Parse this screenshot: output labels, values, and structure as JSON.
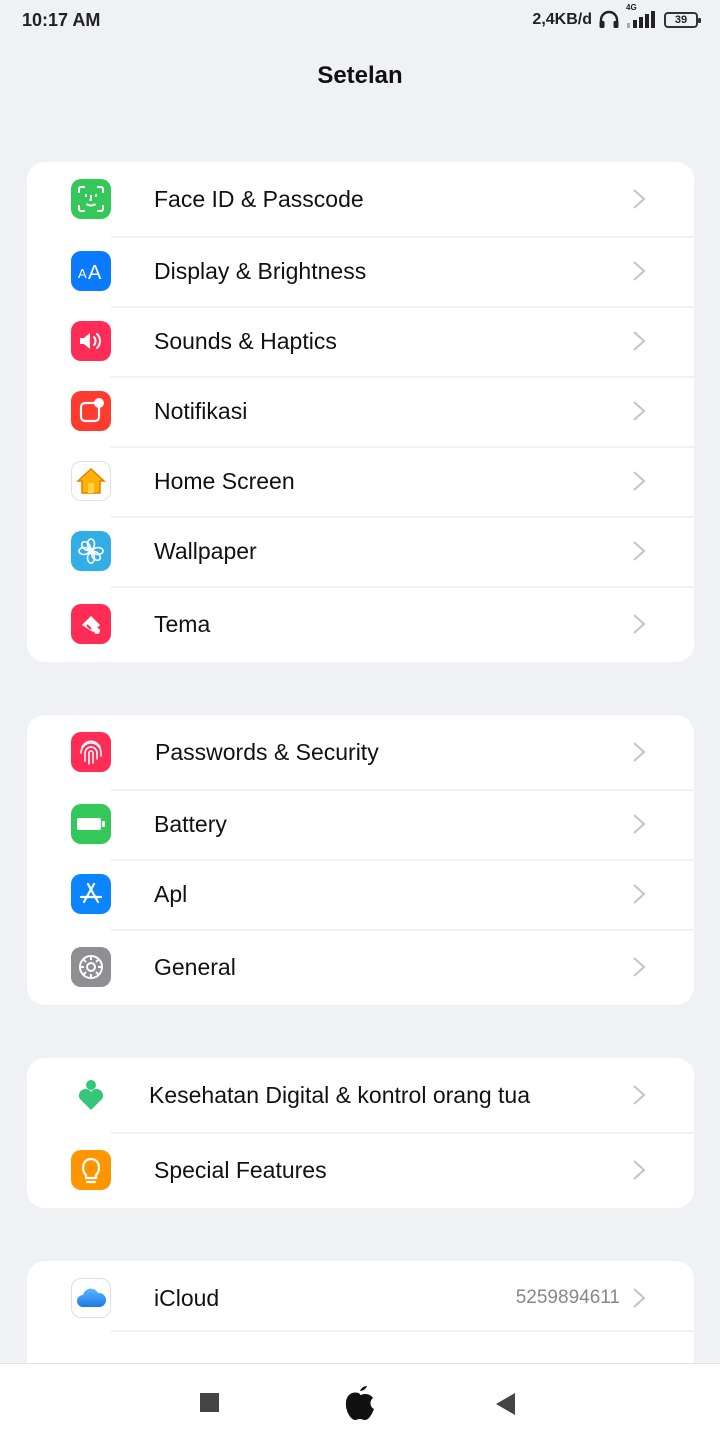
{
  "status_bar": {
    "time": "10:17 AM",
    "net_speed": "2,4KB/d",
    "signal_label": "4G",
    "battery": "39"
  },
  "header": {
    "title": "Setelan"
  },
  "groups": [
    {
      "items": [
        {
          "label": "Face ID & Passcode",
          "icon": "face-id-icon",
          "color": "#34c759"
        },
        {
          "label": "Display & Brightness",
          "icon": "display-brightness-icon",
          "color": "#0a7aff"
        },
        {
          "label": "Sounds & Haptics",
          "icon": "speaker-icon",
          "color": "#ff2d55"
        },
        {
          "label": "Notifikasi",
          "icon": "notification-icon",
          "color": "#ff3b30"
        },
        {
          "label": "Home Screen",
          "icon": "home-icon",
          "color": "#ffb300"
        },
        {
          "label": "Wallpaper",
          "icon": "flower-icon",
          "color": "#32ade6"
        },
        {
          "label": "Tema",
          "icon": "brush-icon",
          "color": "#ff2d55"
        }
      ]
    },
    {
      "items": [
        {
          "label": "Passwords & Security",
          "icon": "fingerprint-icon",
          "color": "#ff2d55"
        },
        {
          "label": "Battery",
          "icon": "battery-icon",
          "color": "#34c759"
        },
        {
          "label": "Apl",
          "icon": "app-store-icon",
          "color": "#0a84ff"
        },
        {
          "label": "General",
          "icon": "gear-icon",
          "color": "#8e8e93"
        }
      ]
    },
    {
      "items": [
        {
          "label": "Kesehatan Digital & kontrol orang tua",
          "icon": "digital-health-icon",
          "color": "#34c77b"
        },
        {
          "label": "Special Features",
          "icon": "lightbulb-icon",
          "color": "#ff9500"
        }
      ]
    },
    {
      "items": [
        {
          "label": "iCloud",
          "value": "5259894611",
          "icon": "icloud-icon",
          "color": "#1e90ff"
        }
      ]
    }
  ],
  "nav": {
    "recents": "square-icon",
    "home": "apple-icon",
    "back": "back-triangle-icon"
  }
}
